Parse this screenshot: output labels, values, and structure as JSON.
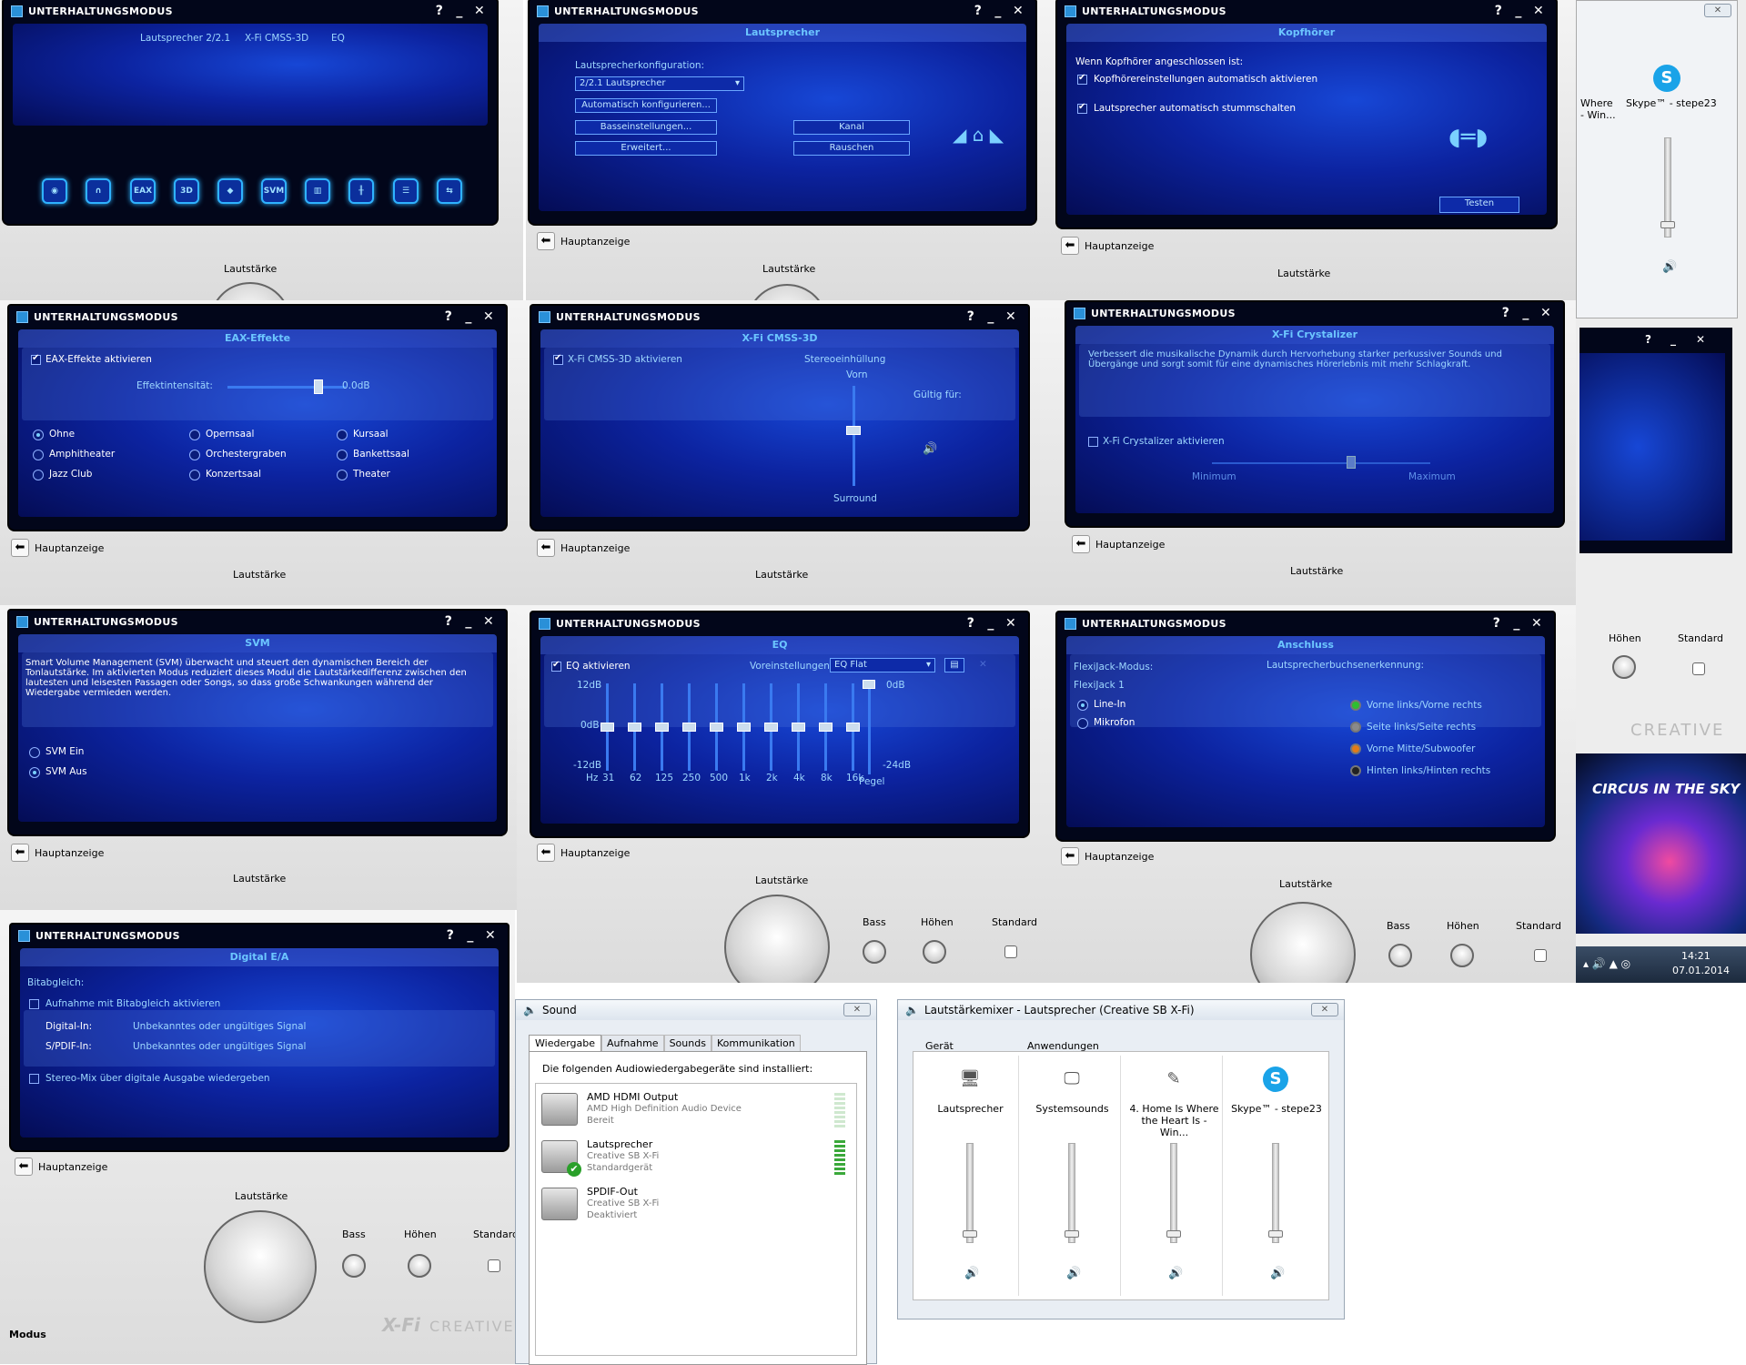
{
  "app": {
    "title": "UNTERHALTUNGSMODUS",
    "help": "?",
    "minimize": "_",
    "close": "✕",
    "back": "Hauptanzeige",
    "volume": "Lautstärke",
    "bass": "Bass",
    "treble": "Höhen",
    "standard": "Standard",
    "mode": "Modus",
    "creative": "CREATIVE",
    "xfi": "X-Fi"
  },
  "main": {
    "links": [
      "Lautsprecher 2/2.1",
      "X-Fi CMSS-3D",
      "EQ"
    ],
    "icons": [
      "speaker-icon",
      "headphones-icon",
      "eax-icon",
      "3d-icon",
      "crystalizer-icon",
      "svm-icon",
      "eq-icon",
      "mixer-icon",
      "settings-icon",
      "connection-icon"
    ],
    "icon_labels": {
      "eax": "EAX",
      "d3": "3D",
      "svm": "SVM"
    }
  },
  "speakers": {
    "header": "Lautsprecher",
    "config_label": "Lautsprecherkonfiguration:",
    "config_value": "2/2.1 Lautsprecher",
    "auto": "Automatisch konfigurieren...",
    "bass": "Basseinstellungen...",
    "adv": "Erweitert...",
    "channel": "Kanal",
    "noise": "Rauschen"
  },
  "headphones": {
    "header": "Kopfhörer",
    "when": "Wenn Kopfhörer angeschlossen ist:",
    "opt1": "Kopfhörereinstellungen automatisch aktivieren",
    "opt2": "Lautsprecher automatisch stummschalten",
    "test": "Testen"
  },
  "eax": {
    "header": "EAX-Effekte",
    "enable": "EAX-Effekte aktivieren",
    "intensity": "Effektintensität:",
    "intensity_value": "0.0dB",
    "presets": [
      "Ohne",
      "Opernsaal",
      "Kursaal",
      "Amphitheater",
      "Orchestergraben",
      "Bankettsaal",
      "Jazz Club",
      "Konzertsaal",
      "Theater"
    ],
    "selected": "Ohne"
  },
  "cmss": {
    "header": "X-Fi CMSS-3D",
    "enable": "X-Fi CMSS-3D aktivieren",
    "stereo": "Stereoeinhüllung",
    "front": "Vorn",
    "valid": "Gültig für:",
    "surround": "Surround"
  },
  "crystal": {
    "header": "X-Fi Crystalizer",
    "desc": "Verbessert die musikalische Dynamik durch Hervorhebung starker perkussiver Sounds und Übergänge und sorgt somit für eine dynamisches Hörerlebnis mit mehr Schlagkraft.",
    "enable": "X-Fi Crystalizer aktivieren",
    "min": "Minimum",
    "max": "Maximum"
  },
  "svm": {
    "header": "SVM",
    "desc": "Smart Volume Management (SVM) überwacht und steuert den dynamischen Bereich der Tonlautstärke. Im aktivierten Modus reduziert dieses Modul die Lautstärkedifferenz zwischen den lautesten und leisesten Passagen oder Songs, so dass große Schwankungen während der Wiedergabe vermieden werden.",
    "on": "SVM Ein",
    "off": "SVM Aus"
  },
  "eq": {
    "header": "EQ",
    "enable": "EQ aktivieren",
    "presets_label": "Voreinstellungen:",
    "preset": "EQ Flat",
    "top": "12dB",
    "mid": "0dB",
    "bottom": "-12dB",
    "hz": "Hz",
    "bands": [
      "31",
      "62",
      "125",
      "250",
      "500",
      "1k",
      "2k",
      "4k",
      "8k",
      "16k"
    ],
    "level_top": "0dB",
    "level_bottom": "-24dB",
    "level": "Pegel"
  },
  "connect": {
    "header": "Anschluss",
    "flexi_mode": "FlexiJack-Modus:",
    "jack_detect": "Lautsprecherbuchsenerkennung:",
    "jack": "FlexiJack 1",
    "linein": "Line-In",
    "mic": "Mikrofon",
    "jacks": [
      "Vorne links/Vorne rechts",
      "Seite links/Seite rechts",
      "Vorne Mitte/Subwoofer",
      "Hinten links/Hinten rechts"
    ],
    "jack_colors": [
      "#2fbf2f",
      "#8a8a8a",
      "#e07b1a",
      "#222222"
    ]
  },
  "digital": {
    "header": "Digital E/A",
    "bitmatch": "Bitabgleich:",
    "rec": "Aufnahme mit Bitabgleich aktivieren",
    "din_label": "Digital-In:",
    "din_value": "Unbekanntes oder ungültiges Signal",
    "spdif_label": "S/PDIF-In:",
    "spdif_value": "Unbekanntes oder ungültiges Signal",
    "stereomix": "Stereo-Mix über digitale Ausgabe wiedergeben"
  },
  "sound": {
    "title": "Sound",
    "tabs": [
      "Wiedergabe",
      "Aufnahme",
      "Sounds",
      "Kommunikation"
    ],
    "intro": "Die folgenden Audiowiedergabegeräte sind installiert:",
    "devices": [
      {
        "name": "AMD HDMI Output",
        "desc": "AMD High Definition Audio Device",
        "status": "Bereit"
      },
      {
        "name": "Lautsprecher",
        "desc": "Creative SB X-Fi",
        "status": "Standardgerät"
      },
      {
        "name": "SPDIF-Out",
        "desc": "Creative SB X-Fi",
        "status": "Deaktiviert"
      }
    ]
  },
  "mixer": {
    "title": "Lautstärkemixer - Lautsprecher (Creative SB X-Fi)",
    "device": "Gerät",
    "apps": "Anwendungen",
    "channels": [
      "Lautsprecher",
      "Systemsounds",
      "4. Home Is Where the Heart Is - Win...",
      "Skype™ - stepe23"
    ]
  },
  "side": {
    "skype": "Skype™ - stepe23",
    "where": "Where\n- Win...",
    "clock": "14:21",
    "date": "07.01.2014",
    "album": "CIRCUS IN THE SKY"
  }
}
